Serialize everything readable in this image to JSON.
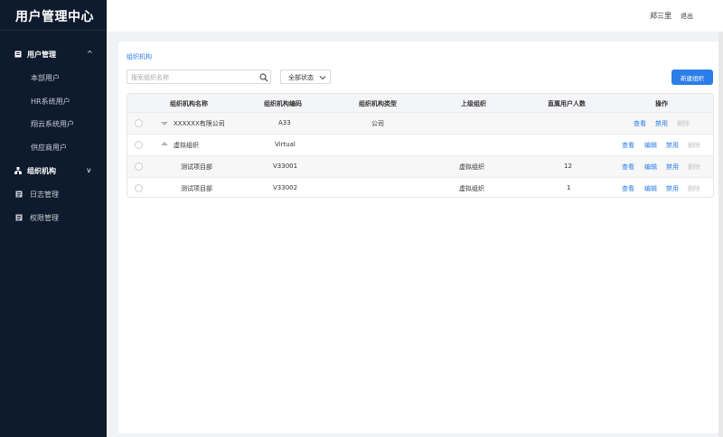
{
  "app": {
    "title": "用户管理中心"
  },
  "sidebar": {
    "groups": [
      {
        "label": "用户管理",
        "icon": "user-card-icon",
        "expanded": true,
        "children": [
          "本部用户",
          "HR系统用户",
          "翔云系统用户",
          "供应商用户"
        ]
      },
      {
        "label": "组织机构",
        "icon": "org-tree-icon",
        "expanded": false
      }
    ],
    "items": [
      {
        "label": "日志管理",
        "icon": "log-icon"
      },
      {
        "label": "权限管理",
        "icon": "permission-icon"
      }
    ]
  },
  "header": {
    "user": "郑三里",
    "logout": "退出"
  },
  "main": {
    "breadcrumb": "组织机构",
    "search": {
      "placeholder": "搜索组织名称",
      "value": ""
    },
    "status_select": {
      "value": "全部状态"
    },
    "new_button": "新建组织",
    "table": {
      "columns": [
        "组织机构名称",
        "组织机构编码",
        "组织机构类型",
        "上级组织",
        "直属用户人数",
        "操作"
      ],
      "rows": [
        {
          "name": "XXXXXX有限公司",
          "code": "A33",
          "type": "公司",
          "parent": "",
          "count": "",
          "tree": "expanded",
          "actions": [
            "查看",
            "禁用",
            "删除"
          ]
        },
        {
          "name": "虚拟组织",
          "code": "Virtual",
          "type": "",
          "parent": "",
          "count": "",
          "tree": "collapsed",
          "actions": [
            "查看",
            "编辑",
            "禁用",
            "删除"
          ]
        },
        {
          "name": "测试项目部",
          "code": "V33001",
          "type": "",
          "parent": "虚拟组织",
          "count": "12",
          "tree": "",
          "actions": [
            "查看",
            "编辑",
            "禁用",
            "删除"
          ]
        },
        {
          "name": "测试项目部",
          "code": "V33002",
          "type": "",
          "parent": "虚拟组织",
          "count": "1",
          "tree": "",
          "actions": [
            "查看",
            "编辑",
            "禁用",
            "删除"
          ]
        }
      ]
    }
  },
  "colors": {
    "sidebar_bg": "#0e1a2d",
    "accent": "#2b7de9",
    "disabled": "#c4c4c4"
  }
}
